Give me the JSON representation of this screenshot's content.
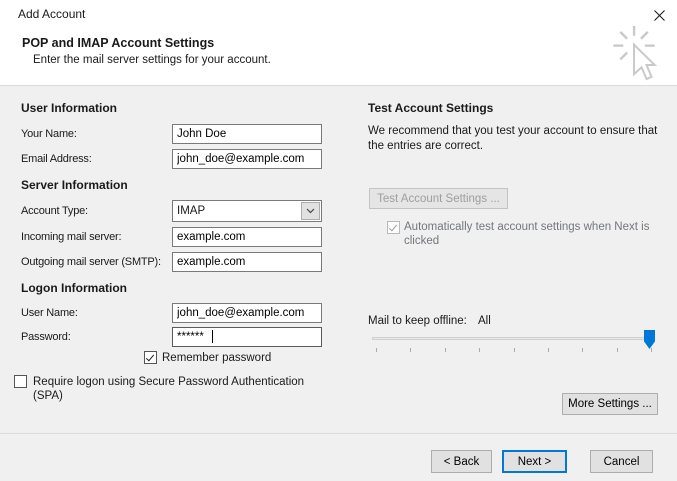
{
  "window": {
    "title": "Add Account"
  },
  "header": {
    "title": "POP and IMAP Account Settings",
    "subtitle": "Enter the mail server settings for your account."
  },
  "user_information": {
    "heading": "User Information",
    "your_name_label": "Your Name:",
    "your_name_value": "John Doe",
    "email_label": "Email Address:",
    "email_value": "john_doe@example.com"
  },
  "server_information": {
    "heading": "Server Information",
    "account_type_label": "Account Type:",
    "account_type_value": "IMAP",
    "incoming_label": "Incoming mail server:",
    "incoming_value": "example.com",
    "outgoing_label": "Outgoing mail server (SMTP):",
    "outgoing_value": "example.com"
  },
  "logon_information": {
    "heading": "Logon Information",
    "username_label": "User Name:",
    "username_value": "john_doe@example.com",
    "password_label": "Password:",
    "password_value": "******",
    "remember_password_label": "Remember password",
    "remember_password_checked": true,
    "spa_label": "Require logon using Secure Password Authentication (SPA)",
    "spa_checked": false
  },
  "test_account": {
    "heading": "Test Account Settings",
    "description": "We recommend that you test your account to ensure that the entries are correct.",
    "test_button_label": "Test Account Settings ...",
    "test_button_enabled": false,
    "auto_test_label": "Automatically test account settings when Next is clicked",
    "auto_test_checked": true,
    "auto_test_enabled": false
  },
  "offline_mail": {
    "label": "Mail to keep offline:",
    "value": "All"
  },
  "buttons": {
    "more_settings": "More Settings ...",
    "back": "< Back",
    "next": "Next >",
    "cancel": "Cancel"
  },
  "icons": {
    "close": "close-icon",
    "chevron": "chevron-down-icon",
    "cursor": "click-cursor-icon",
    "checkmark": "checkmark-icon"
  },
  "colors": {
    "accent": "#0078d7",
    "body_bg": "#f0f0f0",
    "header_bg": "#ffffff"
  }
}
